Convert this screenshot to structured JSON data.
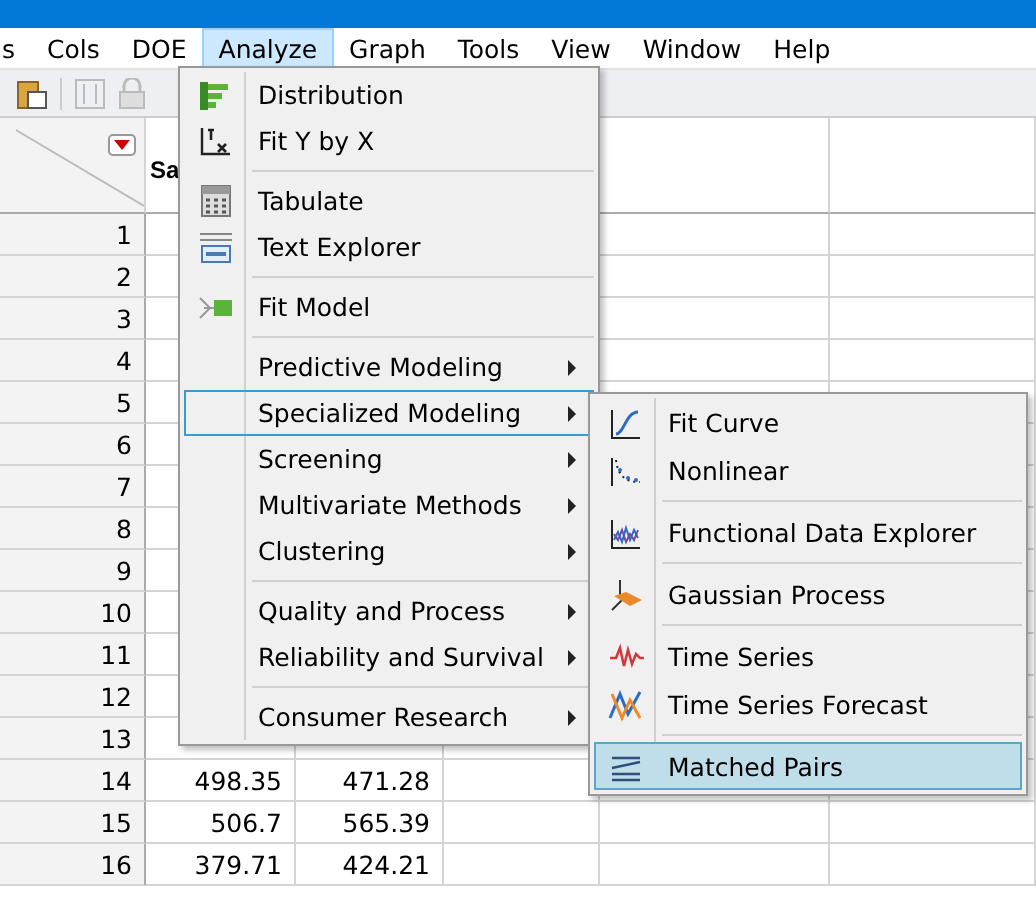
{
  "menubar": {
    "items": [
      {
        "label": "s",
        "selected": false
      },
      {
        "label": "Cols",
        "selected": false
      },
      {
        "label": "DOE",
        "selected": false
      },
      {
        "label": "Analyze",
        "selected": true
      },
      {
        "label": "Graph",
        "selected": false
      },
      {
        "label": "Tools",
        "selected": false
      },
      {
        "label": "View",
        "selected": false
      },
      {
        "label": "Window",
        "selected": false
      },
      {
        "label": "Help",
        "selected": false
      }
    ]
  },
  "table": {
    "columns": [
      "Sa"
    ],
    "rows": [
      {
        "number": "1",
        "cells": []
      },
      {
        "number": "2",
        "cells": []
      },
      {
        "number": "3",
        "cells": []
      },
      {
        "number": "4",
        "cells": []
      },
      {
        "number": "5",
        "cells": []
      },
      {
        "number": "6",
        "cells": []
      },
      {
        "number": "7",
        "cells": []
      },
      {
        "number": "8",
        "cells": []
      },
      {
        "number": "9",
        "cells": []
      },
      {
        "number": "10",
        "cells": []
      },
      {
        "number": "11",
        "cells": []
      },
      {
        "number": "12",
        "cells": []
      },
      {
        "number": "13",
        "cells": []
      },
      {
        "number": "14",
        "cells": [
          "498.35",
          "471.28"
        ]
      },
      {
        "number": "15",
        "cells": [
          "506.7",
          "565.39"
        ]
      },
      {
        "number": "16",
        "cells": [
          "379.71",
          "424.21"
        ]
      }
    ]
  },
  "analyze_menu": {
    "groups": [
      [
        {
          "label": "Distribution",
          "has_submenu": false,
          "selected": false
        },
        {
          "label": "Fit Y by X",
          "has_submenu": false,
          "selected": false
        }
      ],
      [
        {
          "label": "Tabulate",
          "has_submenu": false,
          "selected": false
        },
        {
          "label": "Text Explorer",
          "has_submenu": false,
          "selected": false
        }
      ],
      [
        {
          "label": "Fit Model",
          "has_submenu": false,
          "selected": false
        }
      ],
      [
        {
          "label": "Predictive Modeling",
          "has_submenu": true,
          "selected": false
        },
        {
          "label": "Specialized Modeling",
          "has_submenu": true,
          "selected": true
        },
        {
          "label": "Screening",
          "has_submenu": true,
          "selected": false
        },
        {
          "label": "Multivariate Methods",
          "has_submenu": true,
          "selected": false
        },
        {
          "label": "Clustering",
          "has_submenu": true,
          "selected": false
        }
      ],
      [
        {
          "label": "Quality and Process",
          "has_submenu": true,
          "selected": false
        },
        {
          "label": "Reliability and Survival",
          "has_submenu": true,
          "selected": false
        }
      ],
      [
        {
          "label": "Consumer Research",
          "has_submenu": true,
          "selected": false
        }
      ]
    ]
  },
  "specialized_submenu": {
    "groups": [
      [
        {
          "label": "Fit Curve",
          "has_submenu": false,
          "selected": false
        },
        {
          "label": "Nonlinear",
          "has_submenu": false,
          "selected": false
        }
      ],
      [
        {
          "label": "Functional Data Explorer",
          "has_submenu": false,
          "selected": false
        }
      ],
      [
        {
          "label": "Gaussian Process",
          "has_submenu": false,
          "selected": false
        }
      ],
      [
        {
          "label": "Time Series",
          "has_submenu": false,
          "selected": false
        },
        {
          "label": "Time Series Forecast",
          "has_submenu": false,
          "selected": false
        }
      ],
      [
        {
          "label": "Matched Pairs",
          "has_submenu": false,
          "selected": true
        }
      ]
    ]
  }
}
